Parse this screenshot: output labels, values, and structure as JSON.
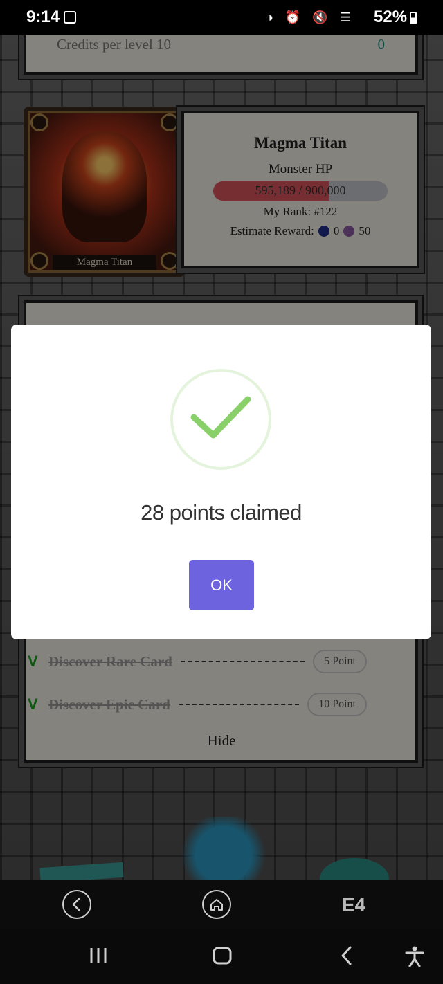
{
  "status_bar": {
    "time": "9:14",
    "battery": "52%"
  },
  "credits_panel": {
    "label": "Credits per level 10",
    "value": "0"
  },
  "boss": {
    "card_name": "Magma Titan",
    "name": "Magma Titan",
    "hp_label": "Monster HP",
    "hp_text": "595,189 / 900,000",
    "hp_fraction": 0.661,
    "rank": "My Rank: #122",
    "reward_label": "Estimate Reward:",
    "reward_blue": "0",
    "reward_purple": "50"
  },
  "quests": [
    {
      "name": "Discover Rare Card",
      "points": "5 Point",
      "done": true,
      "check": "V"
    },
    {
      "name": "Discover Epic Card",
      "points": "10 Point",
      "done": true,
      "check": "V"
    }
  ],
  "hide_label": "Hide",
  "modal": {
    "message": "28 points claimed",
    "ok_label": "OK"
  },
  "app_nav": {
    "logo": "E4"
  },
  "colors": {
    "ok_button": "#6e63df",
    "check_green": "#8ad06a",
    "hp_fill": "#d9555c",
    "quest_check": "#19a31f"
  },
  "icons": {
    "back": "chevron-left-icon",
    "home": "home-icon",
    "success": "checkmark-icon"
  }
}
